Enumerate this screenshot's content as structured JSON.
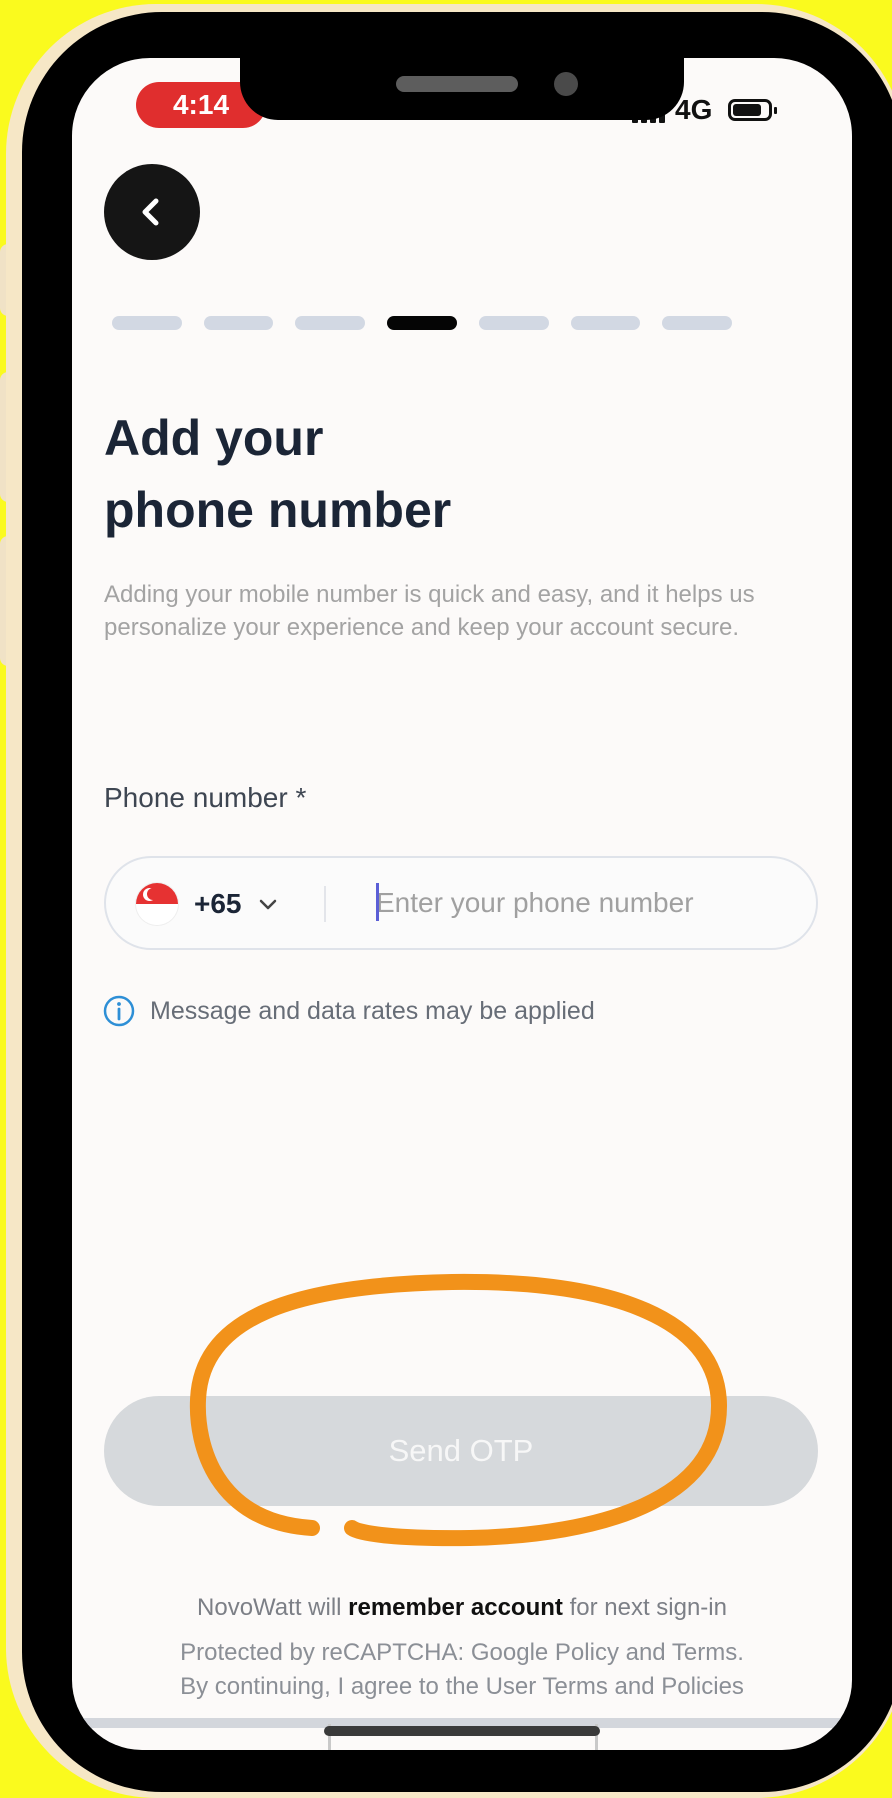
{
  "status_bar": {
    "time": "4:14",
    "network": "4G"
  },
  "onboarding": {
    "steps_total": 7,
    "current_step": 4
  },
  "header": {
    "title_line1": "Add your",
    "title_line2": "phone number"
  },
  "description": "Adding your mobile number is quick and easy, and it helps us personalize your experience and keep your account secure.",
  "phone_field": {
    "label": "Phone number *",
    "country_code": "+65",
    "placeholder": "Enter your phone number",
    "value": ""
  },
  "info_note": "Message and data rates may be applied",
  "send_button": {
    "label": "Send OTP",
    "enabled": false
  },
  "footer": {
    "remember_prefix": "NovoWatt will ",
    "remember_bold": "remember account",
    "remember_suffix": " for next sign-in",
    "legal_line1": "Protected by reCAPTCHA: Google Policy and Terms.",
    "legal_line2": "By continuing, I agree to the User Terms and Policies"
  },
  "colors": {
    "frame_background": "#fafa1e",
    "annotation_circle": "#f2921a",
    "active_step": "#050505",
    "inactive_step": "#d2d8e3",
    "disabled_button": "#d6d9dc",
    "info_icon": "#2e8fd6"
  },
  "icons": [
    "back-arrow-icon",
    "singapore-flag-icon",
    "chevron-down-icon",
    "info-icon",
    "signal-icon",
    "battery-icon"
  ]
}
